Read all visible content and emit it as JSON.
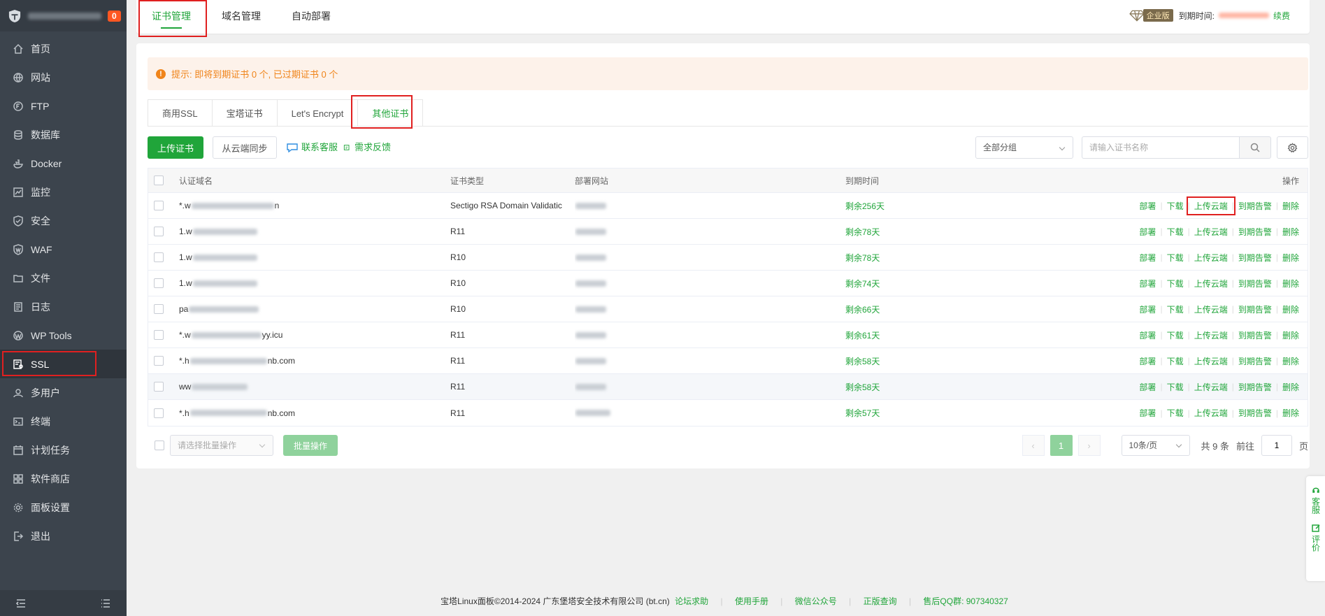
{
  "sidebar": {
    "badge": "0",
    "items": [
      {
        "label": "首页",
        "icon": "home-icon"
      },
      {
        "label": "网站",
        "icon": "globe-icon"
      },
      {
        "label": "FTP",
        "icon": "ftp-icon"
      },
      {
        "label": "数据库",
        "icon": "database-icon"
      },
      {
        "label": "Docker",
        "icon": "docker-icon"
      },
      {
        "label": "监控",
        "icon": "monitor-icon"
      },
      {
        "label": "安全",
        "icon": "shield-icon"
      },
      {
        "label": "WAF",
        "icon": "waf-icon"
      },
      {
        "label": "文件",
        "icon": "folder-icon"
      },
      {
        "label": "日志",
        "icon": "log-icon"
      },
      {
        "label": "WP Tools",
        "icon": "wordpress-icon"
      },
      {
        "label": "SSL",
        "icon": "ssl-icon"
      },
      {
        "label": "多用户",
        "icon": "users-icon"
      },
      {
        "label": "终端",
        "icon": "terminal-icon"
      },
      {
        "label": "计划任务",
        "icon": "calendar-icon"
      },
      {
        "label": "软件商店",
        "icon": "apps-icon"
      },
      {
        "label": "面板设置",
        "icon": "gear-icon"
      },
      {
        "label": "退出",
        "icon": "logout-icon"
      }
    ],
    "active_index": 11
  },
  "header": {
    "tabs": [
      "证书管理",
      "域名管理",
      "自动部署"
    ],
    "edition": "企业版",
    "expire_label": "到期时间:",
    "renew": "续费"
  },
  "alert": {
    "text": "提示: 即将到期证书 0 个, 已过期证书 0 个"
  },
  "subtabs": [
    "商用SSL",
    "宝塔证书",
    "Let's Encrypt",
    "其他证书"
  ],
  "toolbar": {
    "upload": "上传证书",
    "sync": "从云端同步",
    "contact": "联系客服",
    "feedback": "需求反馈",
    "group": "全部分组",
    "search_placeholder": "请输入证书名称"
  },
  "table": {
    "headers": {
      "name": "认证域名",
      "type": "证书类型",
      "site": "部署网站",
      "expire": "到期时间",
      "ops": "操作"
    },
    "ops": [
      "部署",
      "下载",
      "上传云端",
      "到期告警",
      "删除"
    ],
    "rows": [
      {
        "name_pre": "*.w",
        "name_post": "n",
        "type": "Sectigo RSA Domain Validatic",
        "expire": "剩余256天"
      },
      {
        "name_pre": "1.w",
        "name_post": "",
        "type": "R11",
        "expire": "剩余78天"
      },
      {
        "name_pre": "1.w",
        "name_post": "",
        "type": "R10",
        "expire": "剩余78天"
      },
      {
        "name_pre": "1.w",
        "name_post": "",
        "type": "R10",
        "expire": "剩余74天"
      },
      {
        "name_pre": "pa",
        "name_post": "",
        "type": "R10",
        "expire": "剩余66天"
      },
      {
        "name_pre": "*.w",
        "name_post": "yy.icu",
        "type": "R11",
        "expire": "剩余61天"
      },
      {
        "name_pre": "*.h",
        "name_post": "nb.com",
        "type": "R11",
        "expire": "剩余58天"
      },
      {
        "name_pre": "ww",
        "name_post": "",
        "type": "R11",
        "expire": "剩余58天"
      },
      {
        "name_pre": "*.h",
        "name_post": "nb.com",
        "type": "R11",
        "expire": "剩余57天"
      }
    ]
  },
  "footer": {
    "batch_placeholder": "请选择批量操作",
    "batch_btn": "批量操作",
    "page": "1",
    "page_size": "10条/页",
    "total": "共 9 条",
    "goto": "前往",
    "goto_val": "1",
    "page_unit": "页"
  },
  "page_footer": {
    "copyright": "宝塔Linux面板©2014-2024 广东堡塔安全技术有限公司 (bt.cn)",
    "links": [
      "论坛求助",
      "使用手册",
      "微信公众号",
      "正版查询"
    ],
    "qq": "售后QQ群: 907340327"
  },
  "float": {
    "service": "客服",
    "rate": "评价"
  },
  "colors": {
    "accent": "#20a53a",
    "sidebar": "#3c444d",
    "warning": "#f0841a",
    "highlight": "#e02020"
  }
}
